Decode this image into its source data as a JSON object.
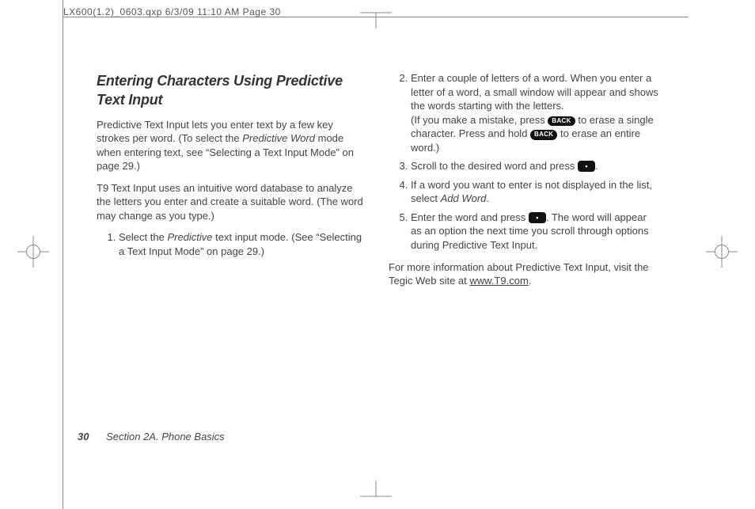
{
  "header": {
    "slug": "LX600(1.2)_0603.qxp  6/3/09  11:10 AM  Page 30"
  },
  "page": {
    "number": "30",
    "section_label": "Section 2A. Phone Basics"
  },
  "left": {
    "title": "Entering Characters Using Predictive Text Input",
    "para1_a": "Predictive Text Input lets you enter text by a few key strokes per word. (To select the ",
    "para1_em": "Predictive Word",
    "para1_b": " mode when entering text, see “Selecting a Text Input Mode” on page 29.)",
    "para2": "T9 Text Input uses an intuitive word database to analyze the letters you enter and create a suitable word. (The word may change as you type.)",
    "step1_a": "Select the ",
    "step1_em": "Predictive",
    "step1_b": " text input mode. (See “Selecting a Text Input Mode” on page 29.)"
  },
  "right": {
    "step2_a": "Enter a couple of letters of a word. When you enter a letter of a word, a small window will appear and shows the words starting with the letters.",
    "step2_b": "(If you make a mistake, press ",
    "step2_key1": "BACK",
    "step2_c": " to erase a single character. Press and hold ",
    "step2_key2": "BACK",
    "step2_d": " to erase an entire word.)",
    "step3_a": "Scroll to the desired word and press ",
    "step3_key": "▪",
    "step3_b": ".",
    "step4_a": "If a word you want to enter is not displayed in the list, select ",
    "step4_em": "Add Word",
    "step4_b": ".",
    "step5_a": "Enter the word and press ",
    "step5_key": "▪",
    "step5_b": ". The word will appear as an option the next time you scroll through options during Predictive Text Input.",
    "closing_a": "For more information about Predictive Text Input, visit the Tegic Web site at ",
    "closing_link": "www.T9.com",
    "closing_b": "."
  }
}
